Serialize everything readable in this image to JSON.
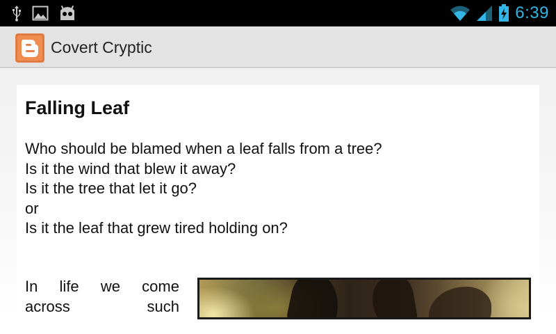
{
  "status_bar": {
    "time": "6:39",
    "left_icons": [
      "usb-icon",
      "image-icon",
      "android-robot-icon"
    ],
    "right_icons": [
      "wifi-icon",
      "signal-icon",
      "battery-charging-icon"
    ],
    "accent_color": "#33b5e5"
  },
  "action_bar": {
    "app_icon": "blogger-logo",
    "title": "Covert Cryptic"
  },
  "post": {
    "title": "Falling Leaf",
    "poem_lines": [
      "Who should be blamed when a leaf falls from a tree?",
      "Is it the wind that blew it away?",
      "Is it the tree that let it go?",
      "or",
      "Is it the leaf that grew tired holding on?"
    ],
    "paragraph_rows": [
      [
        "In",
        "life",
        "we",
        "come"
      ],
      [
        "across",
        "such"
      ]
    ],
    "image_name": "leaf-photo"
  }
}
